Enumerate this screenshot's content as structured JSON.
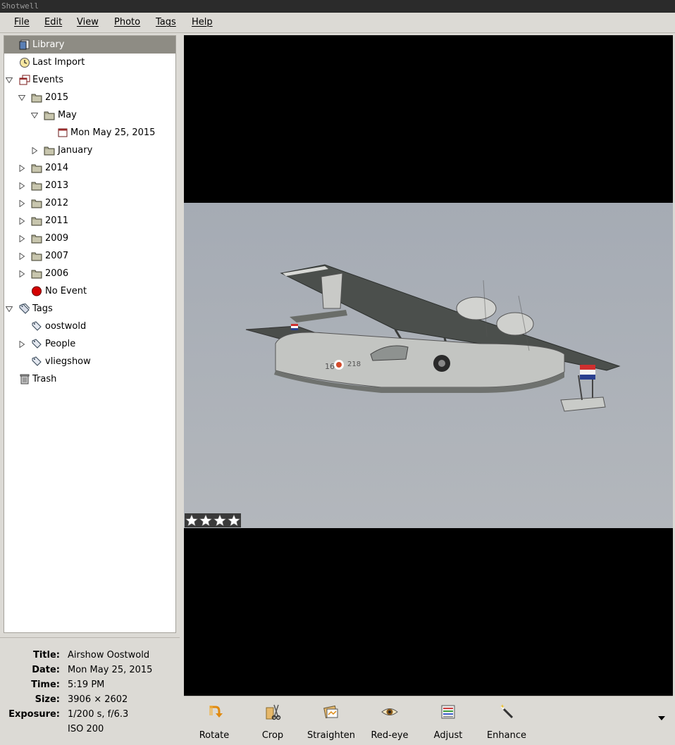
{
  "window": {
    "title": "Shotwell"
  },
  "menu": [
    "File",
    "Edit",
    "View",
    "Photo",
    "Tags",
    "Help"
  ],
  "sidebar": {
    "library": "Library",
    "last_import": "Last Import",
    "events": "Events",
    "year_2015": "2015",
    "month_may": "May",
    "event_may25": "Mon May 25, 2015",
    "month_january": "January",
    "years": [
      "2014",
      "2013",
      "2012",
      "2011",
      "2009",
      "2007",
      "2006"
    ],
    "no_event": "No Event",
    "tags": "Tags",
    "tag_items": [
      "oostwold",
      "People",
      "vliegshow"
    ],
    "trash": "Trash"
  },
  "info": {
    "title_key": "Title:",
    "title_val": "Airshow Oostwold",
    "date_key": "Date:",
    "date_val": "Mon May 25, 2015",
    "time_key": "Time:",
    "time_val": "5:19 PM",
    "size_key": "Size:",
    "size_val": "3906 × 2602",
    "exposure_key": "Exposure:",
    "exposure_val": "1/200 s, f/6.3",
    "iso_val": "ISO 200"
  },
  "photo": {
    "rating_stars": 4,
    "rating_max": 4
  },
  "toolbar": {
    "rotate": "Rotate",
    "crop": "Crop",
    "straighten": "Straighten",
    "redeye": "Red-eye",
    "adjust": "Adjust",
    "enhance": "Enhance"
  },
  "colors": {
    "selection": "#8e8c84",
    "chrome": "#dcdad5",
    "titlebar": "#2b2b2b",
    "sky": "#a9afb7"
  }
}
